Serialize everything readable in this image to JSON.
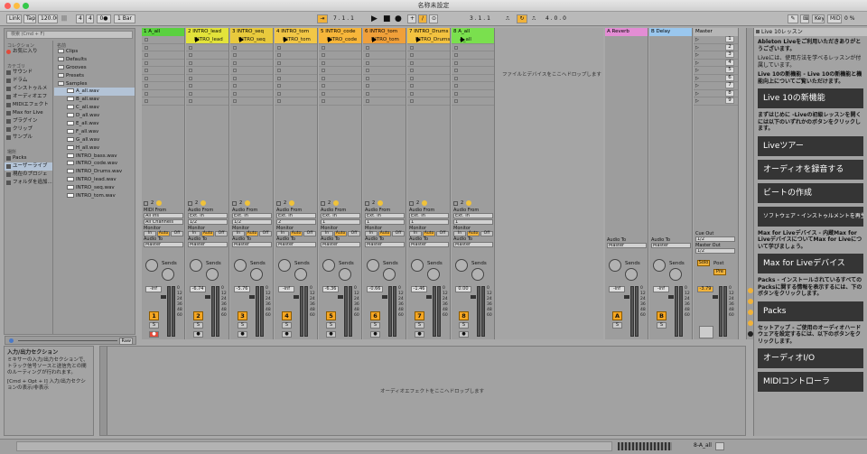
{
  "app": {
    "title": "名称未設定"
  },
  "control_bar": {
    "link": "Link",
    "tap": "Tap",
    "tempo": "120.00",
    "sig_num": "4",
    "sig_den": "4",
    "metro": "0●",
    "quant": "1 Bar",
    "position": "7 . 1 . 1",
    "loop_start": "3 . 1 . 1",
    "loop_len": "4 . 0 . 0",
    "key": "Key",
    "midi": "MIDI",
    "cpu": "0 %"
  },
  "browser": {
    "search_placeholder": "検索 (Cmd + F)",
    "collections_header": "コレクション",
    "collections": [
      "お気に入り"
    ],
    "categories_header": "カテゴリ",
    "categories": [
      "サウンド",
      "ドラム",
      "インストゥルメ",
      "オーディオエフ",
      "MIDIエフェクト",
      "Max for Live",
      "プラグイン",
      "クリップ",
      "サンプル"
    ],
    "places_header": "場所",
    "places": [
      "Packs",
      "ユーザーライブ",
      "現在のプロジェ",
      "フォルダを追加..."
    ],
    "name_header": "名前",
    "items": [
      {
        "label": "Clips",
        "kind": "folder"
      },
      {
        "label": "Defaults",
        "kind": "folder"
      },
      {
        "label": "Grooves",
        "kind": "folder"
      },
      {
        "label": "Presets",
        "kind": "folder"
      },
      {
        "label": "Samples",
        "kind": "folder"
      },
      {
        "label": "A_all.wav",
        "kind": "wav",
        "selected": true
      },
      {
        "label": "B_all.wav",
        "kind": "wav"
      },
      {
        "label": "C_all.wav",
        "kind": "wav"
      },
      {
        "label": "D_all.wav",
        "kind": "wav"
      },
      {
        "label": "E_all.wav",
        "kind": "wav"
      },
      {
        "label": "F_all.wav",
        "kind": "wav"
      },
      {
        "label": "G_all.wav",
        "kind": "wav"
      },
      {
        "label": "H_all.wav",
        "kind": "wav"
      },
      {
        "label": "INTRO_bass.wav",
        "kind": "wav"
      },
      {
        "label": "INTRO_code.wav",
        "kind": "wav"
      },
      {
        "label": "INTRO_Drums.wav",
        "kind": "wav"
      },
      {
        "label": "INTRO_lead.wav",
        "kind": "wav"
      },
      {
        "label": "INTRO_seq.wav",
        "kind": "wav"
      },
      {
        "label": "INTRO_tom.wav",
        "kind": "wav"
      }
    ],
    "preview": "Raw"
  },
  "info": {
    "title": "入力/出力セクション",
    "body": "ミキサーの入力/出力セクションで、トラック信号ソースと送信先との間のルーティングが行われます。",
    "shortcut": "[Cmd + Opt + I] 入力/出力セクションの表示/非表示"
  },
  "tracks": [
    {
      "name": "1 A_all",
      "color": "#5ad13f",
      "clip": "",
      "type": "midi",
      "in1": "All Ins",
      "in2": "All Channels",
      "vol": "-inf",
      "num": "1",
      "sends_label": "Sends",
      "io_label": "MIDI From"
    },
    {
      "name": "2 INTRO_lead",
      "color": "#e3e33a",
      "clip": "INTRO_lead",
      "type": "audio",
      "in1": "Ext. In",
      "in2": "1/2",
      "vol": "-6.74",
      "num": "2",
      "sends_label": "Sends",
      "io_label": "Audio From"
    },
    {
      "name": "3 INTRO_seq",
      "color": "#e9ca3d",
      "clip": "INTRO_seq",
      "type": "audio",
      "in1": "Ext. In",
      "in2": "1/2",
      "vol": "-5.76",
      "num": "3",
      "sends_label": "Sends",
      "io_label": "Audio From"
    },
    {
      "name": "4 INTRO_tom",
      "color": "#f2c746",
      "clip": "INTRO_tom",
      "type": "audio",
      "in1": "Ext. In",
      "in2": "2",
      "vol": "-inf",
      "num": "4",
      "sends_label": "Sends",
      "io_label": "Audio From"
    },
    {
      "name": "5 INTRO_code",
      "color": "#f7b63a",
      "clip": "INTRO_code",
      "type": "audio",
      "in1": "Ext. In",
      "in2": "1",
      "vol": "-6.36",
      "num": "5",
      "sends_label": "Sends",
      "io_label": "Audio From"
    },
    {
      "name": "6 INTRO_tom",
      "color": "#f0a03a",
      "clip": "INTRO_tom",
      "type": "audio",
      "in1": "Ext. In",
      "in2": "1",
      "vol": "-0.66",
      "num": "6",
      "sends_label": "Sends",
      "io_label": "Audio From"
    },
    {
      "name": "7 INTRO_Drums",
      "color": "#f3c240",
      "clip": "INTRO_Drums",
      "type": "audio",
      "in1": "Ext. In",
      "in2": "1",
      "vol": "-1.46",
      "num": "7",
      "sends_label": "Sends",
      "io_label": "Audio From"
    },
    {
      "name": "8 A_all",
      "color": "#7ae04e",
      "clip": "A_all",
      "type": "audio",
      "in1": "Ext. In",
      "in2": "1",
      "vol": "0.00",
      "num": "8",
      "sends_label": "Sends",
      "io_label": "Audio From"
    }
  ],
  "track_labels": {
    "monitor": "Monitor",
    "in": "In",
    "auto": "Auto",
    "off": "Off",
    "audio_to": "Audio To",
    "master": "Master",
    "no_input": "No Input"
  },
  "returns": [
    {
      "name": "A Reverb",
      "color": "#e38dd4",
      "vol": "-inf",
      "num": "A"
    },
    {
      "name": "B Delay",
      "color": "#9ac7ee",
      "vol": "-inf",
      "num": "B"
    }
  ],
  "master": {
    "name": "Master",
    "color": "#b6b6b6",
    "scenes": [
      "1",
      "2",
      "3",
      "4",
      "5",
      "6",
      "7",
      "8",
      "9"
    ],
    "vol": "-3.79",
    "cue_out": "Cue Out",
    "cue_val": "1/2",
    "master_out": "Master Out",
    "master_val": "1/2",
    "solo": "Solo",
    "post": "Post",
    "pre": "Pre"
  },
  "meter_scale": [
    "0",
    "12",
    "24",
    "36",
    "48",
    "60"
  ],
  "dropzone": {
    "session": "ファイルとデバイスをここへドロップします",
    "devices": "オーディオエフェクトをここへドロップします"
  },
  "help": {
    "title": "Live 10レッスン",
    "p1": "Ableton Liveをご利用いただきありがとうございます。",
    "p2": "Liveには、使用方法を学べるレッスンが付属しています。",
    "p3": "Live 10の新機能 - Live 10の新機能と機能向上についてご覧いただけます。",
    "b1": "Live 10の新機能",
    "p4": "まずはじめに -Liveの初級レッスンを開くには以下のいずれかのボタンをクリックします。",
    "b2": "Liveツアー",
    "b3": "オーディオを録音する",
    "b4": "ビートの作成",
    "b5": "ソフトウェア・インストゥルメントを再生する",
    "p5": "Max for Liveデバイス - 内蔵Max for LiveデバイスについてMax for Liveについて学びましょう。",
    "b6": "Max for Liveデバイス",
    "p6": "Packs - インストールされているすべてのPacksに関する情報を表示するには、下のボタンをクリックします。",
    "b7": "Packs",
    "p7": "セットアップ - ご使用のオーディオハードウェアを設定するには、以下のボタンをクリックします。",
    "b8": "オーディオI/O",
    "b9": "MIDIコントローラ"
  },
  "status": {
    "track_name": "8-A_all"
  }
}
